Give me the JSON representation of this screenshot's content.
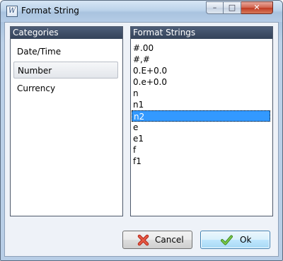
{
  "window": {
    "title": "Format String",
    "app_icon": "W"
  },
  "titlebar_buttons": {
    "minimize": "–",
    "maximize": "□",
    "close": "✕"
  },
  "categories": {
    "header": "Categories",
    "items": [
      "Date/Time",
      "Number",
      "Currency"
    ],
    "selected": "Number"
  },
  "format_strings": {
    "header": "Format Strings",
    "items": [
      "#.00",
      "#,#",
      "0.E+0.0",
      "0.e+0.0",
      "n",
      "n1",
      "n2",
      "e",
      "e1",
      "f",
      "f1"
    ],
    "selected": "n2"
  },
  "buttons": {
    "cancel": "Cancel",
    "ok": "Ok"
  },
  "colors": {
    "selection": "#3399ff",
    "panel_header": "#3d4c66",
    "cancel_icon": "#d23a2a",
    "ok_icon": "#5aa632"
  }
}
